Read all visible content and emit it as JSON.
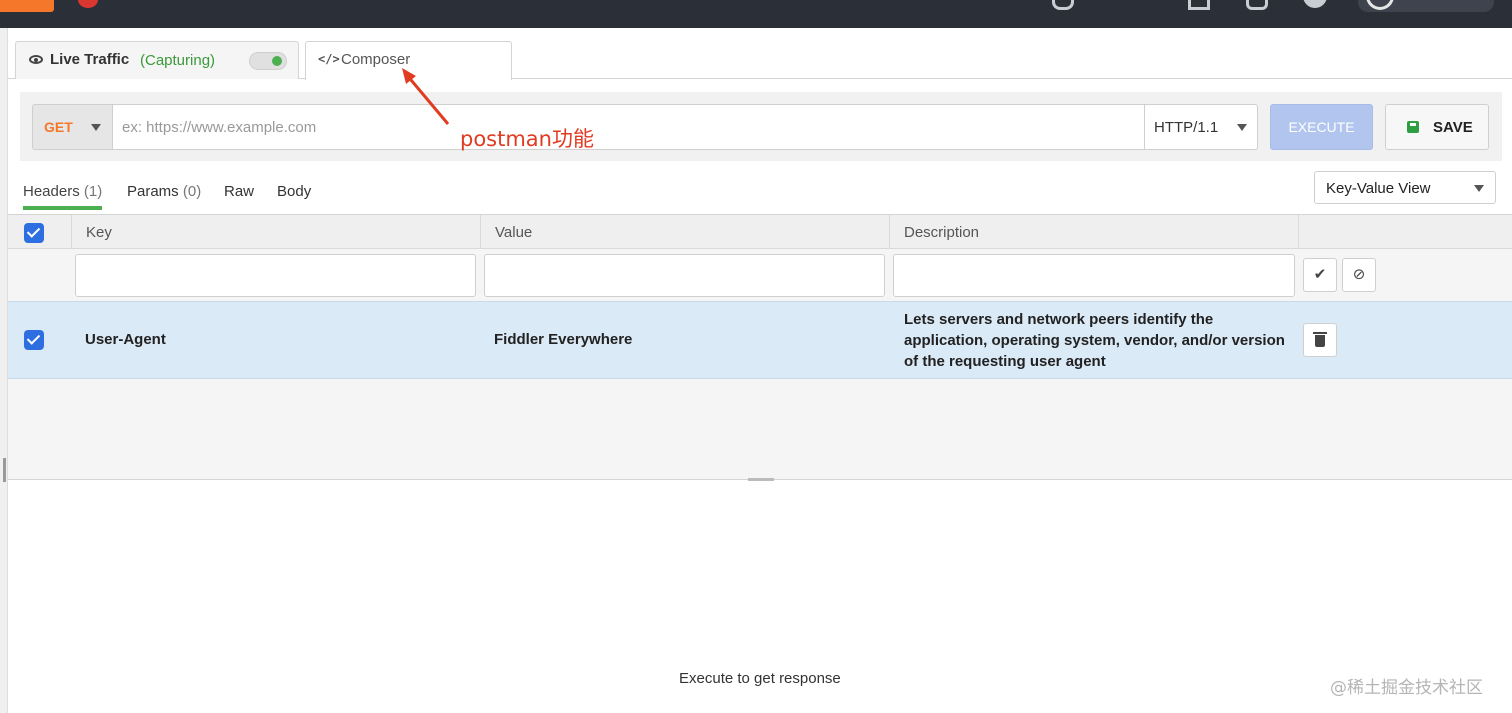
{
  "tabs": {
    "live_traffic": {
      "label": "Live Traffic",
      "status": "(Capturing)"
    },
    "composer": {
      "label": "Composer",
      "icon": "code-icon"
    }
  },
  "request": {
    "method": "GET",
    "url_placeholder": "ex: https://www.example.com",
    "http_version": "HTTP/1.1",
    "execute_label": "EXECUTE",
    "save_label": "SAVE"
  },
  "annotation": {
    "text": "postman功能",
    "color": "#e03c22"
  },
  "subtabs": [
    {
      "label": "Headers",
      "count": "(1)",
      "active": true
    },
    {
      "label": "Params",
      "count": "(0)"
    },
    {
      "label": "Raw"
    },
    {
      "label": "Body"
    }
  ],
  "view_select": {
    "selected": "Key-Value View"
  },
  "grid": {
    "columns": [
      "Key",
      "Value",
      "Description"
    ],
    "rows": [
      {
        "checked": true,
        "key": "User-Agent",
        "value": "Fiddler Everywhere",
        "description": "Lets servers and network peers identify the application, operating system, vendor, and/or version of the requesting user agent"
      }
    ]
  },
  "response": {
    "empty_text": "Execute to get response"
  },
  "watermark": "@稀土掘金技术社区",
  "colors": {
    "accent": "#f5782a",
    "capturing_green": "#3a9a3a",
    "active_tab_underline": "#4caf50",
    "execute_disabled": "#b2c5ee",
    "row_selected": "#dbeaf7",
    "checkbox": "#2d6ee0"
  }
}
